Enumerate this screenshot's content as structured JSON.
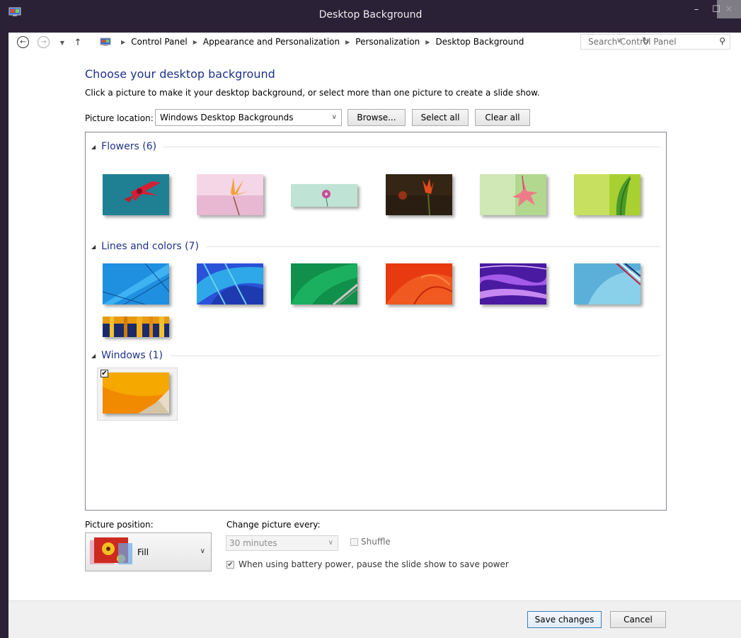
{
  "window": {
    "title": "Desktop Background"
  },
  "nav": {
    "breadcrumbs": [
      "Control Panel",
      "Appearance and Personalization",
      "Personalization",
      "Desktop Background"
    ],
    "search_placeholder": "Search Control Panel"
  },
  "main": {
    "heading": "Choose your desktop background",
    "instructions": "Click a picture to make it your desktop background, or select more than one picture to create a slide show.",
    "location_label": "Picture location:",
    "location_value": "Windows Desktop Backgrounds",
    "browse_label": "Browse...",
    "select_all_label": "Select all",
    "clear_all_label": "Clear all"
  },
  "groups": [
    {
      "title": "Flowers (6)"
    },
    {
      "title": "Lines and colors (7)"
    },
    {
      "title": "Windows (1)"
    }
  ],
  "selected_wallpaper": "windows-1",
  "options": {
    "position_label": "Picture position:",
    "position_value": "Fill",
    "interval_label": "Change picture every:",
    "interval_value": "30 minutes",
    "shuffle_label": "Shuffle",
    "shuffle_checked": false,
    "battery_label": "When using battery power, pause the slide show to save power",
    "battery_checked": true
  },
  "footer": {
    "save_label": "Save changes",
    "cancel_label": "Cancel"
  },
  "icons": [
    "control-panel-icon",
    "back-arrow-icon",
    "forward-arrow-icon",
    "recent-locations-icon",
    "up-arrow-icon",
    "refresh-icon",
    "search-icon",
    "minimize-icon",
    "maximize-icon",
    "close-icon",
    "collapse-triangle-icon",
    "checkmark-icon",
    "chevron-down-icon"
  ],
  "colors": {
    "accent": "#1e3287",
    "title_bg": "#2b2137"
  }
}
